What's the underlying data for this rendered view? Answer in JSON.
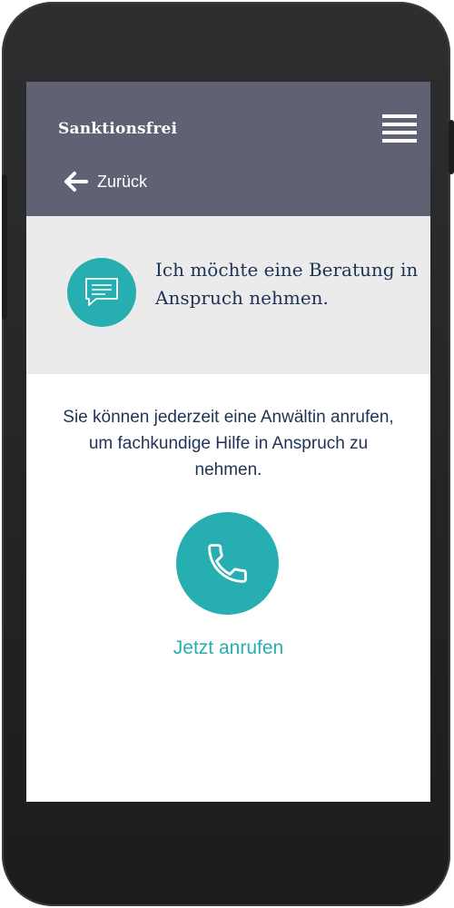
{
  "app": {
    "brand": "Sanktionsfrei"
  },
  "header": {
    "menu_icon": "hamburger-menu-icon",
    "back_label": "Zurück",
    "back_icon": "arrow-left-icon"
  },
  "intro": {
    "icon": "chat-bubble-icon",
    "text": "Ich möchte eine Beratung in Anspruch nehmen."
  },
  "main": {
    "description": "Sie können jederzeit eine Anwältin anrufen, um fachkundige Hilfe in Anspruch zu nehmen.",
    "call_icon": "phone-icon",
    "call_label": "Jetzt anrufen"
  },
  "colors": {
    "app_bar": "#606274",
    "accent": "#27aeb1",
    "text_dark": "#1f3356",
    "intro_bg": "#ebebeb"
  }
}
